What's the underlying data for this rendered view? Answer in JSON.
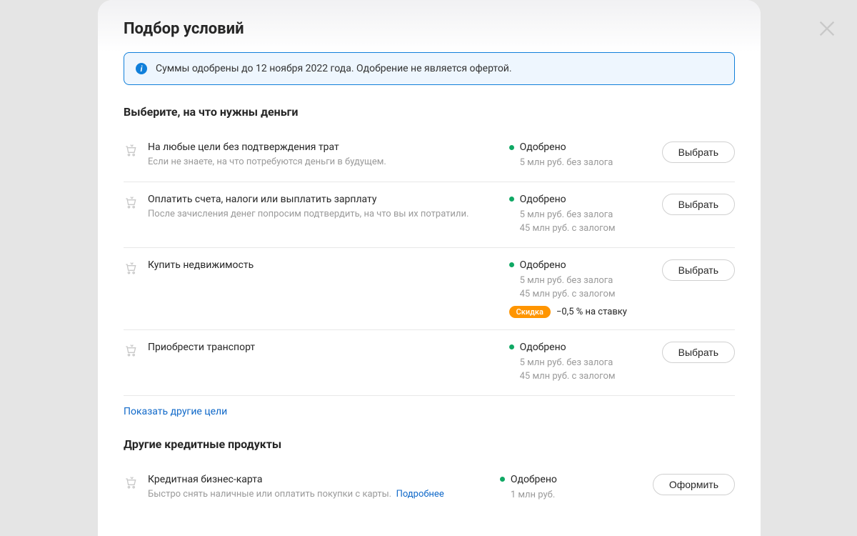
{
  "modal": {
    "title": "Подбор условий"
  },
  "banner": {
    "text": "Суммы одобрены до 12 ноября 2022 года. Одобрение не является офертой."
  },
  "section1": {
    "title": "Выберите, на что нужны деньги"
  },
  "options": [
    {
      "title": "На любые цели без подтверждения трат",
      "desc": "Если не знаете, на что потребуются деньги в будущем.",
      "status": "Одобрено",
      "lines": [
        "5 млн руб. без залога"
      ],
      "button": "Выбрать"
    },
    {
      "title": "Оплатить счета, налоги или выплатить зарплату",
      "desc": "После зачисления денег попросим подтвердить, на что вы их потратили.",
      "status": "Одобрено",
      "lines": [
        "5 млн руб. без залога",
        "45 млн руб. с залогом"
      ],
      "button": "Выбрать"
    },
    {
      "title": "Купить недвижимость",
      "desc": "",
      "status": "Одобрено",
      "lines": [
        "5 млн руб. без залога",
        "45 млн руб. с залогом"
      ],
      "discount_badge": "Скидка",
      "discount_text": "−0,5 % на ставку",
      "button": "Выбрать"
    },
    {
      "title": "Приобрести транспорт",
      "desc": "",
      "status": "Одобрено",
      "lines": [
        "5 млн руб. без залога",
        "45 млн руб. с залогом"
      ],
      "button": "Выбрать"
    }
  ],
  "show_more": "Показать другие цели",
  "section2": {
    "title": "Другие кредитные продукты"
  },
  "other_products": [
    {
      "title": "Кредитная бизнес-карта",
      "desc": "Быстро снять наличные или оплатить покупки с карты.",
      "desc_link": "Подробнее",
      "status": "Одобрено",
      "lines": [
        "1 млн руб."
      ],
      "button": "Оформить"
    }
  ]
}
